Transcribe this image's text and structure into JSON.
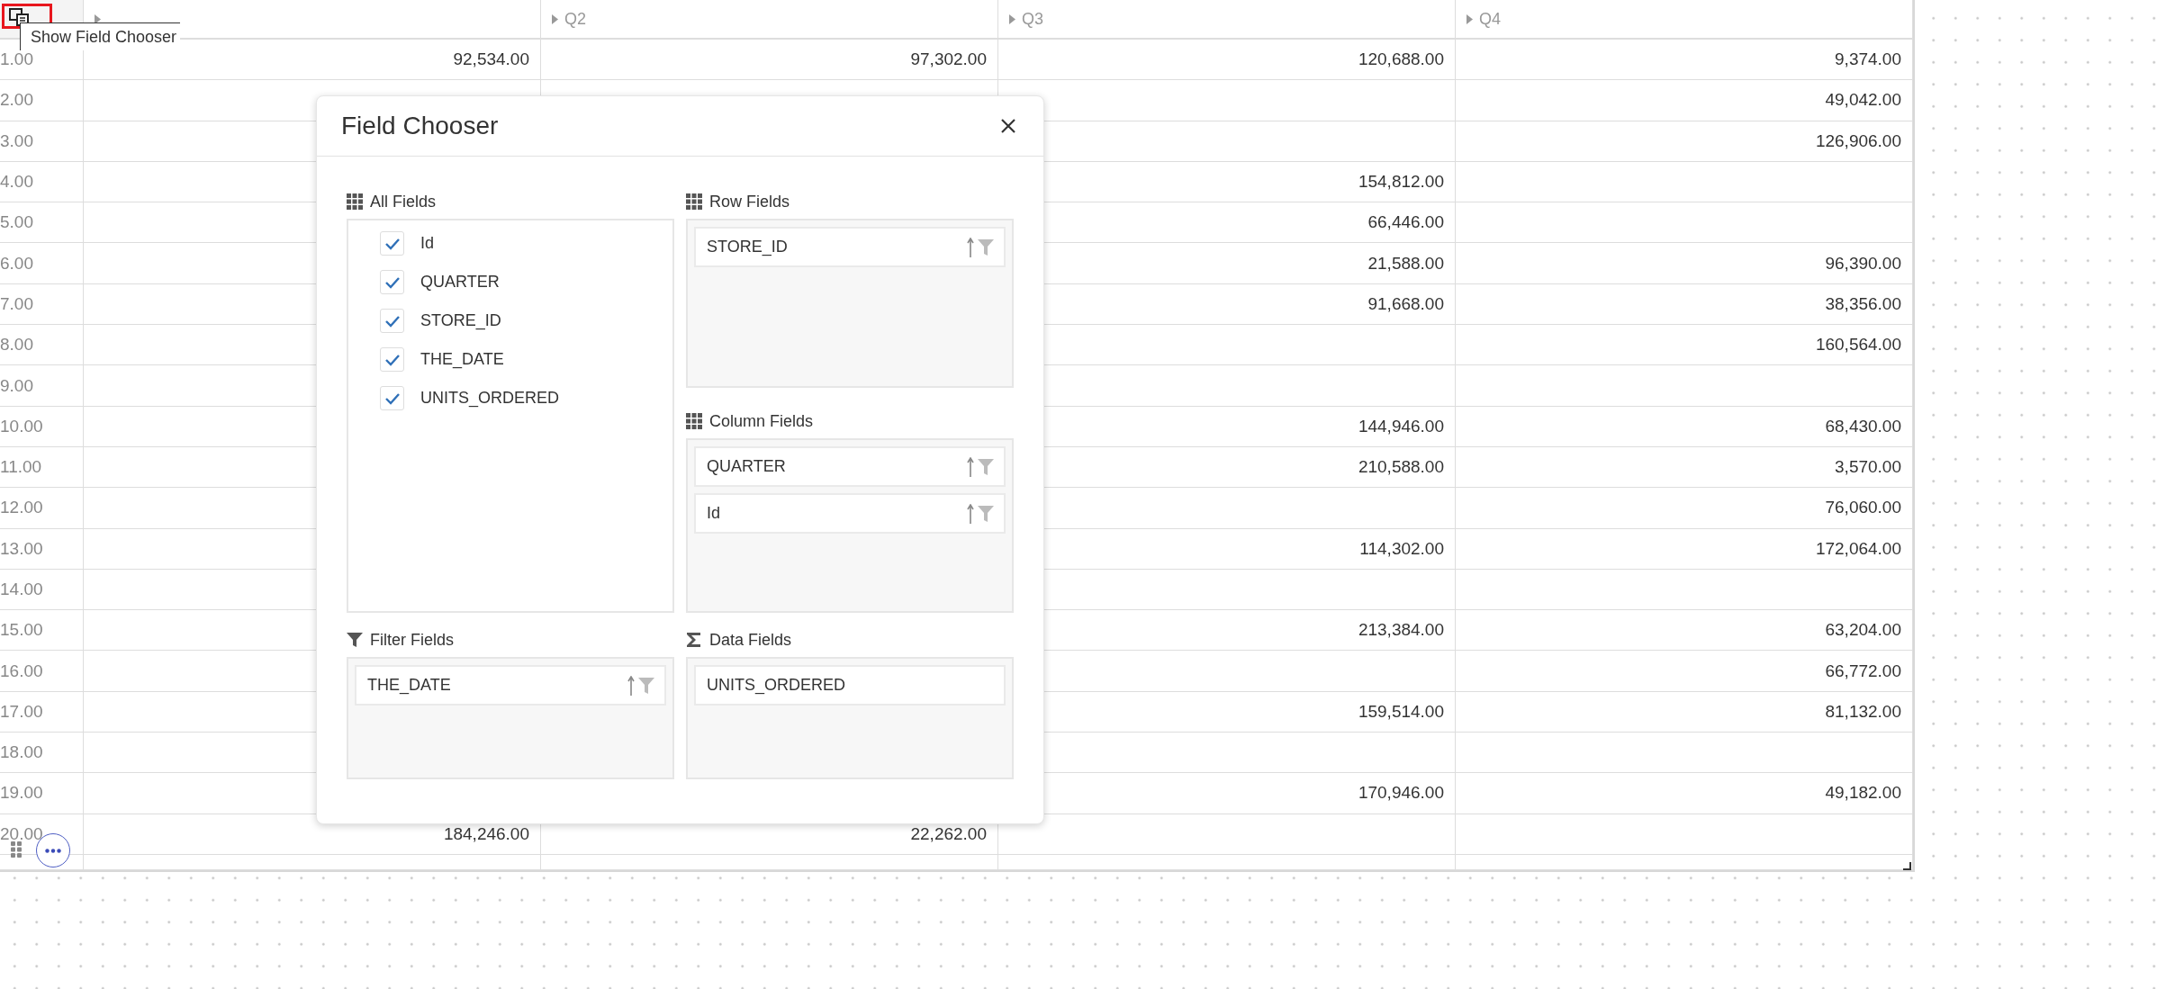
{
  "tooltip": {
    "text": "Show Field Chooser"
  },
  "grid": {
    "columns": [
      {},
      {
        "label": "Q2"
      },
      {
        "label": "Q3"
      },
      {
        "label": "Q4"
      }
    ],
    "rows": [
      {
        "label": "1.00",
        "cells": [
          "92,534.00",
          "97,302.00",
          "120,688.00",
          "9,374.00"
        ]
      },
      {
        "label": "2.00",
        "cells": [
          null,
          null,
          null,
          "49,042.00"
        ]
      },
      {
        "label": "3.00",
        "cells": [
          null,
          null,
          null,
          "126,906.00"
        ]
      },
      {
        "label": "4.00",
        "cells": [
          null,
          null,
          "154,812.00",
          null
        ]
      },
      {
        "label": "5.00",
        "cells": [
          null,
          null,
          "66,446.00",
          null
        ]
      },
      {
        "label": "6.00",
        "cells": [
          null,
          null,
          "21,588.00",
          "96,390.00"
        ]
      },
      {
        "label": "7.00",
        "cells": [
          null,
          null,
          "91,668.00",
          "38,356.00"
        ]
      },
      {
        "label": "8.00",
        "cells": [
          null,
          null,
          null,
          "160,564.00"
        ]
      },
      {
        "label": "9.00",
        "cells": [
          null,
          null,
          null,
          null
        ]
      },
      {
        "label": "10.00",
        "cells": [
          null,
          null,
          "144,946.00",
          "68,430.00"
        ]
      },
      {
        "label": "11.00",
        "cells": [
          null,
          null,
          "210,588.00",
          "3,570.00"
        ]
      },
      {
        "label": "12.00",
        "cells": [
          null,
          null,
          null,
          "76,060.00"
        ]
      },
      {
        "label": "13.00",
        "cells": [
          null,
          null,
          "114,302.00",
          "172,064.00"
        ]
      },
      {
        "label": "14.00",
        "cells": [
          null,
          null,
          null,
          null
        ]
      },
      {
        "label": "15.00",
        "cells": [
          null,
          null,
          "213,384.00",
          "63,204.00"
        ]
      },
      {
        "label": "16.00",
        "cells": [
          null,
          null,
          null,
          "66,772.00"
        ]
      },
      {
        "label": "17.00",
        "cells": [
          null,
          null,
          "159,514.00",
          "81,132.00"
        ]
      },
      {
        "label": "18.00",
        "cells": [
          null,
          null,
          null,
          null
        ]
      },
      {
        "label": "19.00",
        "cells": [
          null,
          null,
          "170,946.00",
          "49,182.00"
        ]
      },
      {
        "label": "20.00",
        "cells": [
          "184,246.00",
          "22,262.00",
          null,
          null
        ]
      }
    ]
  },
  "dialog": {
    "title": "Field Chooser",
    "all_fields": {
      "title": "All Fields",
      "items": [
        {
          "label": "Id",
          "checked": true
        },
        {
          "label": "QUARTER",
          "checked": true
        },
        {
          "label": "STORE_ID",
          "checked": true
        },
        {
          "label": "THE_DATE",
          "checked": true
        },
        {
          "label": "UNITS_ORDERED",
          "checked": true
        }
      ]
    },
    "row_fields": {
      "title": "Row Fields",
      "items": [
        {
          "label": "STORE_ID",
          "sortable": true
        }
      ]
    },
    "column_fields": {
      "title": "Column Fields",
      "items": [
        {
          "label": "QUARTER",
          "sortable": true
        },
        {
          "label": "Id",
          "sortable": true
        }
      ]
    },
    "filter_fields": {
      "title": "Filter Fields",
      "items": [
        {
          "label": "THE_DATE",
          "sortable": true
        }
      ]
    },
    "data_fields": {
      "title": "Data Fields",
      "items": [
        {
          "label": "UNITS_ORDERED",
          "sortable": false
        }
      ]
    }
  }
}
